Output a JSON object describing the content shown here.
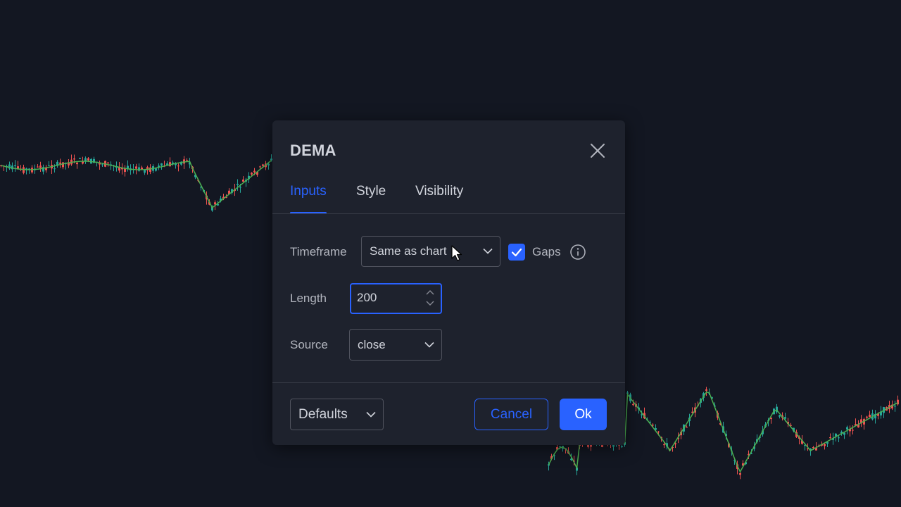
{
  "dialog": {
    "title": "DEMA",
    "tabs": [
      {
        "label": "Inputs",
        "active": true
      },
      {
        "label": "Style",
        "active": false
      },
      {
        "label": "Visibility",
        "active": false
      }
    ],
    "inputs": {
      "timeframe": {
        "label": "Timeframe",
        "value": "Same as chart"
      },
      "gaps": {
        "label": "Gaps",
        "checked": true
      },
      "length": {
        "label": "Length",
        "value": "200"
      },
      "source": {
        "label": "Source",
        "value": "close"
      }
    },
    "footer": {
      "defaults_label": "Defaults",
      "cancel_label": "Cancel",
      "ok_label": "Ok"
    }
  },
  "colors": {
    "background": "#131722",
    "dialog": "#1e222d",
    "accent": "#2962ff",
    "candle_up": "#26a69a",
    "candle_down": "#ef5350",
    "ma_line": "#4caf50"
  },
  "icons": [
    "close-icon",
    "chevron-down-icon",
    "check-icon",
    "info-icon",
    "arrow-up-icon",
    "arrow-down-icon",
    "mouse-cursor-icon"
  ]
}
